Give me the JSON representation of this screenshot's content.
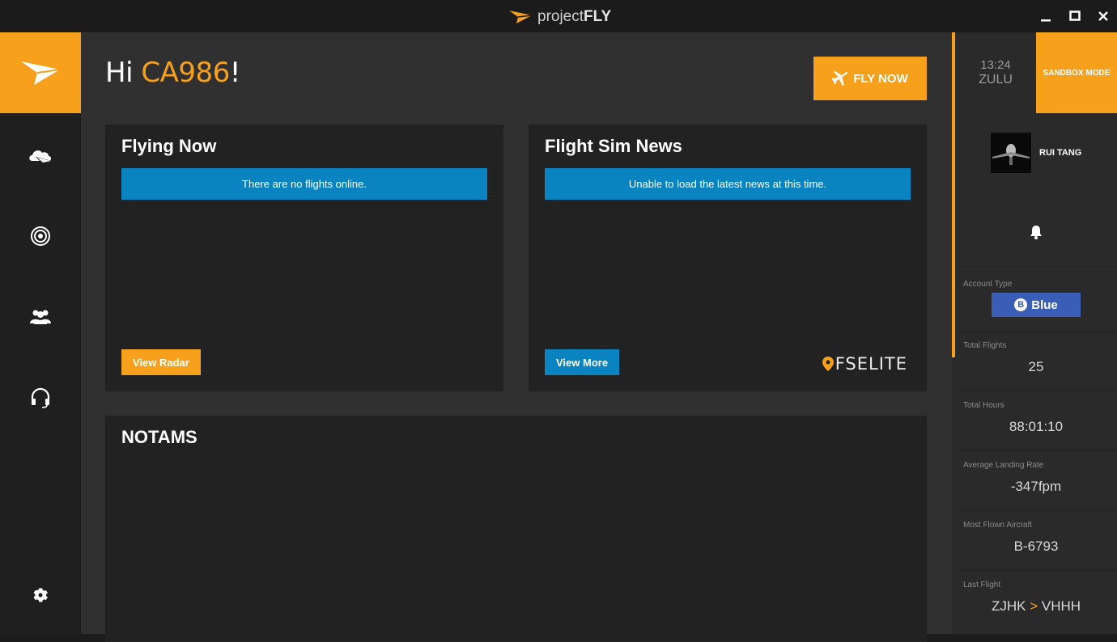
{
  "app": {
    "title_prefix": "project",
    "title_suffix": "FLY"
  },
  "window_controls": [
    "minimize-icon",
    "maximize-icon",
    "close-icon"
  ],
  "sidebar": {
    "logo_icon": "paper-plane-icon",
    "items": [
      {
        "name": "dashboard",
        "icon": "cloud-plane-icon"
      },
      {
        "name": "radar",
        "icon": "radar-icon"
      },
      {
        "name": "community",
        "icon": "users-icon"
      },
      {
        "name": "support",
        "icon": "headset-icon"
      },
      {
        "name": "settings",
        "icon": "gear-icon"
      }
    ]
  },
  "header": {
    "greeting_prefix": "Hi ",
    "username": "CA986",
    "greeting_suffix": "!",
    "fly_now_label": "FLY NOW"
  },
  "flying_now": {
    "title": "Flying Now",
    "message": "There are no flights online.",
    "button_label": "View Radar"
  },
  "news": {
    "title": "Flight Sim News",
    "message": "Unable to load the latest news at this time.",
    "button_label": "View More",
    "source_logo": "FSELITE"
  },
  "notams": {
    "title": "NOTAMS"
  },
  "right_panel": {
    "time": "13:24",
    "zone": "ZULU",
    "sandbox_label": "SANDBOX MODE",
    "profile_name": "RUI TANG",
    "account_type_label": "Account Type",
    "account_type_badge_letter": "B",
    "account_type_value": "Blue",
    "stats": [
      {
        "label": "Total Flights",
        "value": "25"
      },
      {
        "label": "Total Hours",
        "value": "88:01:10"
      },
      {
        "label": "Average Landing Rate",
        "value": "-347fpm"
      },
      {
        "label": "Most Flown Aircraft",
        "value": "B-6793"
      }
    ],
    "last_flight": {
      "label": "Last Flight",
      "from": "ZJHK",
      "arrow": ">",
      "to": "VHHH"
    }
  },
  "colors": {
    "accent": "#f7a01b",
    "info": "#0a84c0",
    "account_blue": "#3a5eb5"
  }
}
